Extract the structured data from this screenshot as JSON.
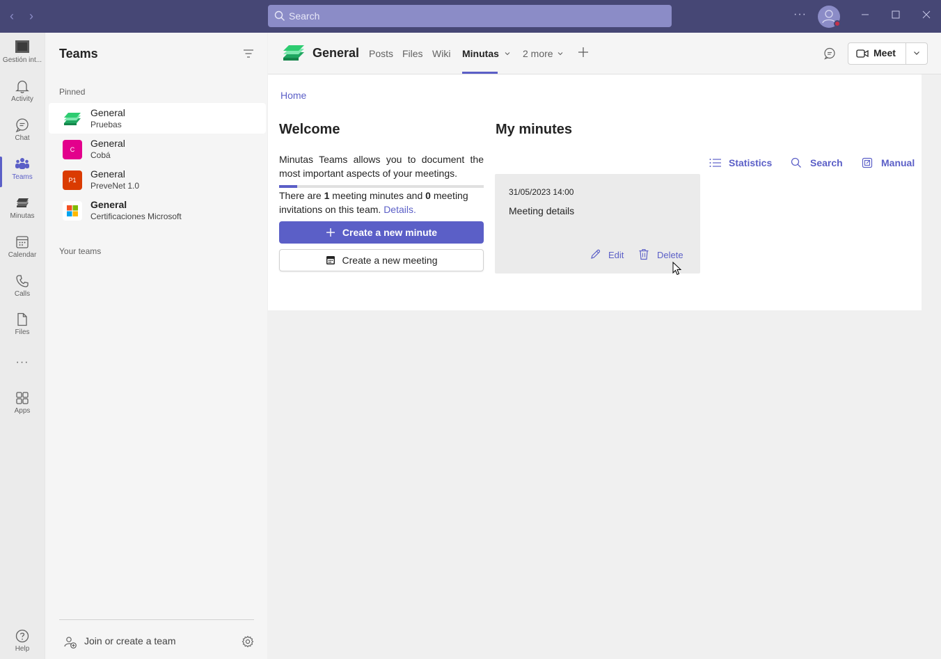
{
  "titlebar": {
    "search_placeholder": "Search",
    "back_glyph": "‹",
    "forward_glyph": "›",
    "more_glyph": "···",
    "presence_color": "#c4314b"
  },
  "rail": {
    "items": [
      {
        "label": "Gestión int...",
        "icon": "app-logo-icon"
      },
      {
        "label": "Activity",
        "icon": "bell-icon"
      },
      {
        "label": "Chat",
        "icon": "chat-icon"
      },
      {
        "label": "Teams",
        "icon": "teams-icon",
        "active": true
      },
      {
        "label": "Minutas",
        "icon": "minutas-icon"
      },
      {
        "label": "Calendar",
        "icon": "calendar-icon"
      },
      {
        "label": "Calls",
        "icon": "phone-icon"
      },
      {
        "label": "Files",
        "icon": "file-icon"
      },
      {
        "label": "Apps",
        "icon": "apps-icon"
      },
      {
        "label": "Help",
        "icon": "help-icon"
      }
    ],
    "more_glyph": "···"
  },
  "teams_pane": {
    "title": "Teams",
    "pinned_label": "Pinned",
    "your_teams_label": "Your teams",
    "pinned": [
      {
        "name": "General",
        "team": "Pruebas",
        "icon_color": "#2ecc71",
        "selected": true
      },
      {
        "name": "General",
        "team": "Cobá",
        "icon_text": "C",
        "icon_color": "#e3008c"
      },
      {
        "name": "General",
        "team": "PreveNet 1.0",
        "icon_text": "P1",
        "icon_color": "#da3b01"
      },
      {
        "name": "General",
        "team": "Certificaciones Microsoft",
        "icon_color": "#ffffff",
        "bold": true
      }
    ],
    "join_label": "Join or create a team"
  },
  "channel": {
    "title": "General",
    "tabs": [
      {
        "label": "Posts"
      },
      {
        "label": "Files"
      },
      {
        "label": "Wiki"
      },
      {
        "label": "Minutas",
        "active": true
      },
      {
        "label": "2 more"
      }
    ],
    "meet_label": "Meet"
  },
  "content": {
    "breadcrumb": "Home",
    "welcome_title": "Welcome",
    "welcome_text": "Minutas Teams allows you to document the most important aspects of your meetings.",
    "progress_fraction": 0.09,
    "count_prefix": "There are ",
    "minutes_count": "1",
    "count_middle": " meeting minutes and ",
    "invitations_count": "0",
    "count_suffix": " meeting invitations on this team. ",
    "details_link": "Details.",
    "create_minute_label": "Create a new minute",
    "create_meeting_label": "Create a new meeting",
    "minutes_title": "My minutes",
    "actions": [
      {
        "label": "Statistics",
        "icon": "list-icon"
      },
      {
        "label": "Search",
        "icon": "search-icon"
      },
      {
        "label": "Manual",
        "icon": "open-external-icon"
      }
    ],
    "card": {
      "date": "31/05/2023 14:00",
      "title": "Meeting details",
      "edit_label": "Edit",
      "delete_label": "Delete"
    }
  },
  "colors": {
    "brand": "#5b5fc7",
    "titlebar": "#464775"
  }
}
